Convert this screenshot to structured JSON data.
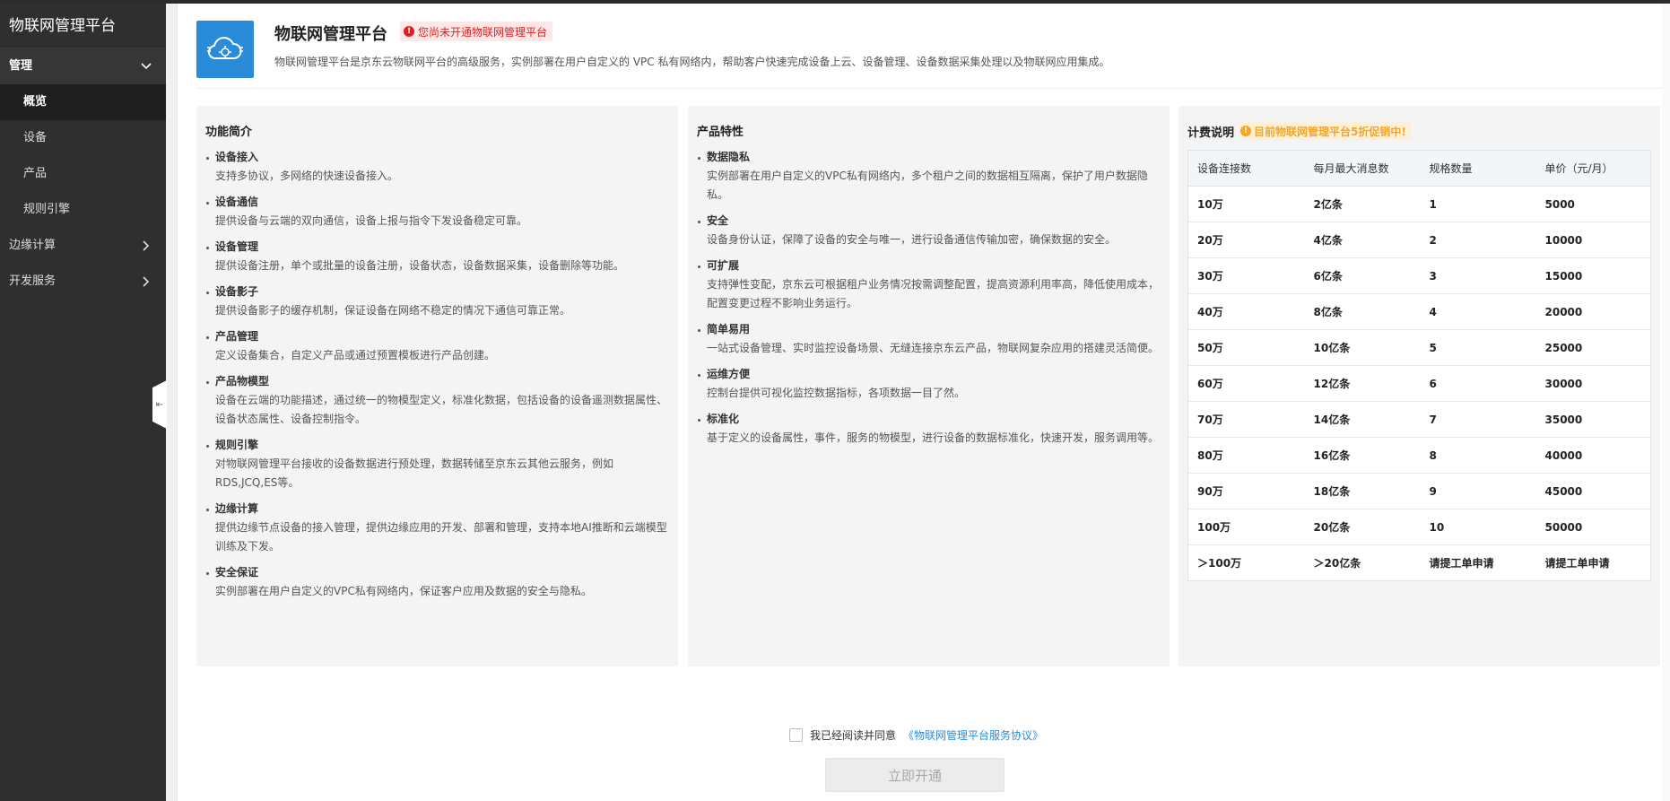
{
  "sidebar": {
    "brand": "物联网管理平台",
    "group_label": "管理",
    "sub_items": [
      {
        "label": "概览",
        "active": true
      },
      {
        "label": "设备",
        "active": false
      },
      {
        "label": "产品",
        "active": false
      },
      {
        "label": "规则引擎",
        "active": false
      }
    ],
    "menu_items": [
      {
        "label": "边缘计算"
      },
      {
        "label": "开发服务"
      }
    ]
  },
  "header": {
    "title": "物联网管理平台",
    "warning": "您尚未开通物联网管理平台",
    "description": "物联网管理平台是京东云物联网平台的高级服务，实例部署在用户自定义的 VPC 私有网络内，帮助客户快速完成设备上云、设备管理、设备数据采集处理以及物联网应用集成。",
    "icon": "cloud-gear-icon"
  },
  "intro": {
    "title": "功能简介",
    "items": [
      {
        "title": "设备接入",
        "desc": "支持多协议，多网络的快速设备接入。"
      },
      {
        "title": "设备通信",
        "desc": "提供设备与云端的双向通信，设备上报与指令下发设备稳定可靠。"
      },
      {
        "title": "设备管理",
        "desc": "提供设备注册，单个或批量的设备注册，设备状态，设备数据采集，设备删除等功能。"
      },
      {
        "title": "设备影子",
        "desc": "提供设备影子的缓存机制，保证设备在网络不稳定的情况下通信可靠正常。"
      },
      {
        "title": "产品管理",
        "desc": "定义设备集合，自定义产品或通过预置模板进行产品创建。"
      },
      {
        "title": "产品物模型",
        "desc": "设备在云端的功能描述，通过统一的物模型定义，标准化数据，包括设备的设备遥测数据属性、设备状态属性、设备控制指令。"
      },
      {
        "title": "规则引擎",
        "desc": "对物联网管理平台接收的设备数据进行预处理，数据转储至京东云其他云服务，例如RDS,JCQ,ES等。"
      },
      {
        "title": "边缘计算",
        "desc": "提供边缘节点设备的接入管理，提供边缘应用的开发、部署和管理，支持本地AI推断和云端模型训练及下发。"
      },
      {
        "title": "安全保证",
        "desc": "实例部署在用户自定义的VPC私有网络内，保证客户应用及数据的安全与隐私。"
      }
    ]
  },
  "features": {
    "title": "产品特性",
    "items": [
      {
        "title": "数据隐私",
        "desc": "实例部署在用户自定义的VPC私有网络内，多个租户之间的数据相互隔离，保护了用户数据隐私。"
      },
      {
        "title": "安全",
        "desc": "设备身份认证，保障了设备的安全与唯一，进行设备通信传输加密，确保数据的安全。"
      },
      {
        "title": "可扩展",
        "desc": "支持弹性变配，京东云可根据租户业务情况按需调整配置，提高资源利用率高，降低使用成本，配置变更过程不影响业务运行。"
      },
      {
        "title": "简单易用",
        "desc": "一站式设备管理、实时监控设备场景、无缝连接京东云产品，物联网复杂应用的搭建灵活简便。"
      },
      {
        "title": "运维方便",
        "desc": "控制台提供可视化监控数据指标，各项数据一目了然。"
      },
      {
        "title": "标准化",
        "desc": "基于定义的设备属性，事件，服务的物模型，进行设备的数据标准化，快速开发，服务调用等。"
      }
    ]
  },
  "pricing": {
    "title": "计费说明",
    "promo": "目前物联网管理平台5折促销中!",
    "headers": [
      "设备连接数",
      "每月最大消息数",
      "规格数量",
      "单价（元/月）"
    ],
    "rows": [
      [
        "10万",
        "2亿条",
        "1",
        "5000"
      ],
      [
        "20万",
        "4亿条",
        "2",
        "10000"
      ],
      [
        "30万",
        "6亿条",
        "3",
        "15000"
      ],
      [
        "40万",
        "8亿条",
        "4",
        "20000"
      ],
      [
        "50万",
        "10亿条",
        "5",
        "25000"
      ],
      [
        "60万",
        "12亿条",
        "6",
        "30000"
      ],
      [
        "70万",
        "14亿条",
        "7",
        "35000"
      ],
      [
        "80万",
        "16亿条",
        "8",
        "40000"
      ],
      [
        "90万",
        "18亿条",
        "9",
        "45000"
      ],
      [
        "100万",
        "20亿条",
        "10",
        "50000"
      ],
      [
        "＞100万",
        "＞20亿条",
        "请提工单申请",
        "请提工单申请"
      ]
    ]
  },
  "footer": {
    "agree_text": "我已经阅读并同意",
    "agree_link": "《物联网管理平台服务协议》",
    "submit_label": "立即开通"
  },
  "colors": {
    "sidebar_bg": "#2f2f2f",
    "accent": "#2a8cd8",
    "warning": "#e02020",
    "promo": "#f5a623"
  }
}
